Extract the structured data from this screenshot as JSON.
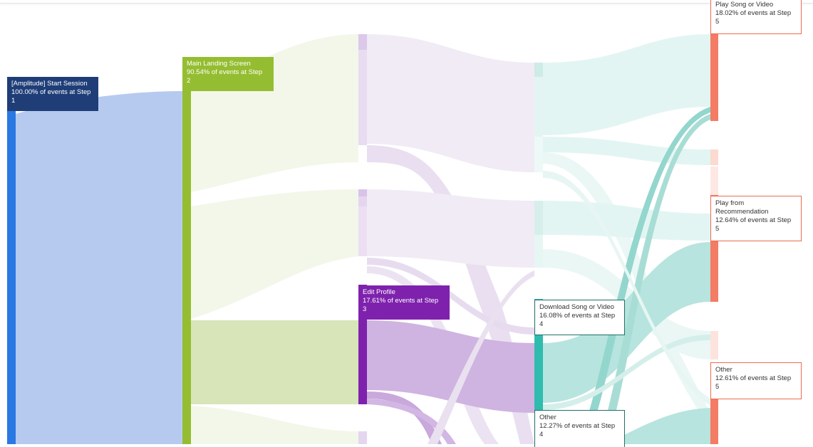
{
  "colors": {
    "step1": "#2a78e3",
    "step2": "#95bd31",
    "step3": "#7e22ad",
    "step4": "#2fbcae",
    "step5": "#f47b64",
    "session_label_bg": "#1f3e78"
  },
  "nodes": {
    "start_session": {
      "name": "[Amplitude] Start Session",
      "percent": "100.00% of events at Step",
      "step": "1"
    },
    "main_landing": {
      "name": "Main Landing Screen",
      "percent": "90.54% of events at Step",
      "step": "2"
    },
    "edit_profile": {
      "name": "Edit Profile",
      "percent": "17.61% of events at Step",
      "step": "3"
    },
    "download_song": {
      "name": "Download Song or Video",
      "percent": "16.08% of events at Step",
      "step": "4"
    },
    "other_step4": {
      "name": "Other",
      "percent": "12.27% of events at Step",
      "step": "4"
    },
    "play_song": {
      "name": "Play Song or Video",
      "percent": "18.02% of events at Step",
      "step": "5"
    },
    "play_recommendation": {
      "name": "Play from Recommendation",
      "percent": "12.64% of events at Step",
      "step": "5"
    },
    "other_step5": {
      "name": "Other",
      "percent": "12.61% of events at Step",
      "step": "5"
    }
  }
}
